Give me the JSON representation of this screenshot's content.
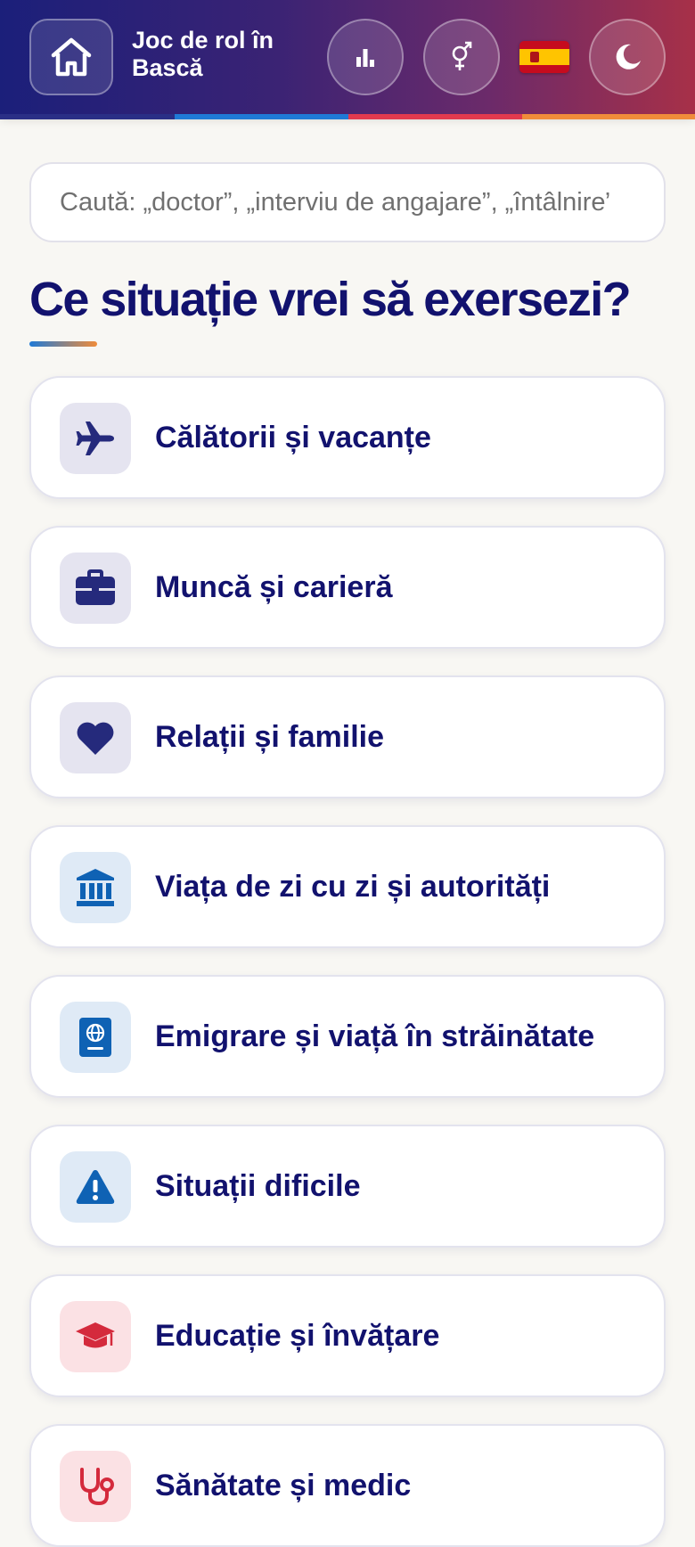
{
  "header": {
    "title": "Joc de rol în Bască",
    "home_icon": "home-icon",
    "stats_icon": "bar-chart-icon",
    "gender_icon": "gender-icon",
    "language_flag": "spain-flag-icon",
    "theme_icon": "moon-icon",
    "stripe_colors": [
      "#2a2f86",
      "#1f7ad6",
      "#e23a4e",
      "#f08c3a"
    ]
  },
  "search": {
    "placeholder": "Caută: „doctor”, „interviu de angajare”, „întâlnire”..."
  },
  "main": {
    "heading": "Ce situație vrei să exersezi?"
  },
  "categories": [
    {
      "label": "Călătorii și vacanțe",
      "icon": "airplane-icon",
      "icon_bg": "#e5e4f0",
      "icon_color": "#252a7c"
    },
    {
      "label": "Muncă și carieră",
      "icon": "briefcase-icon",
      "icon_bg": "#e5e4f0",
      "icon_color": "#252a7c"
    },
    {
      "label": "Relații și familie",
      "icon": "heart-icon",
      "icon_bg": "#e5e4f0",
      "icon_color": "#252a7c"
    },
    {
      "label": "Viața de zi cu zi și autorități",
      "icon": "bank-icon",
      "icon_bg": "#dfeaf6",
      "icon_color": "#0f62b4"
    },
    {
      "label": "Emigrare și viață în străinătate",
      "icon": "passport-icon",
      "icon_bg": "#dfeaf6",
      "icon_color": "#0f62b4"
    },
    {
      "label": "Situații dificile",
      "icon": "warning-icon",
      "icon_bg": "#dfeaf6",
      "icon_color": "#0f62b4"
    },
    {
      "label": "Educație și învățare",
      "icon": "graduation-cap-icon",
      "icon_bg": "#fbe1e4",
      "icon_color": "#d42a3c"
    },
    {
      "label": "Sănătate și medic",
      "icon": "stethoscope-icon",
      "icon_bg": "#fbe1e4",
      "icon_color": "#d42a3c"
    }
  ]
}
